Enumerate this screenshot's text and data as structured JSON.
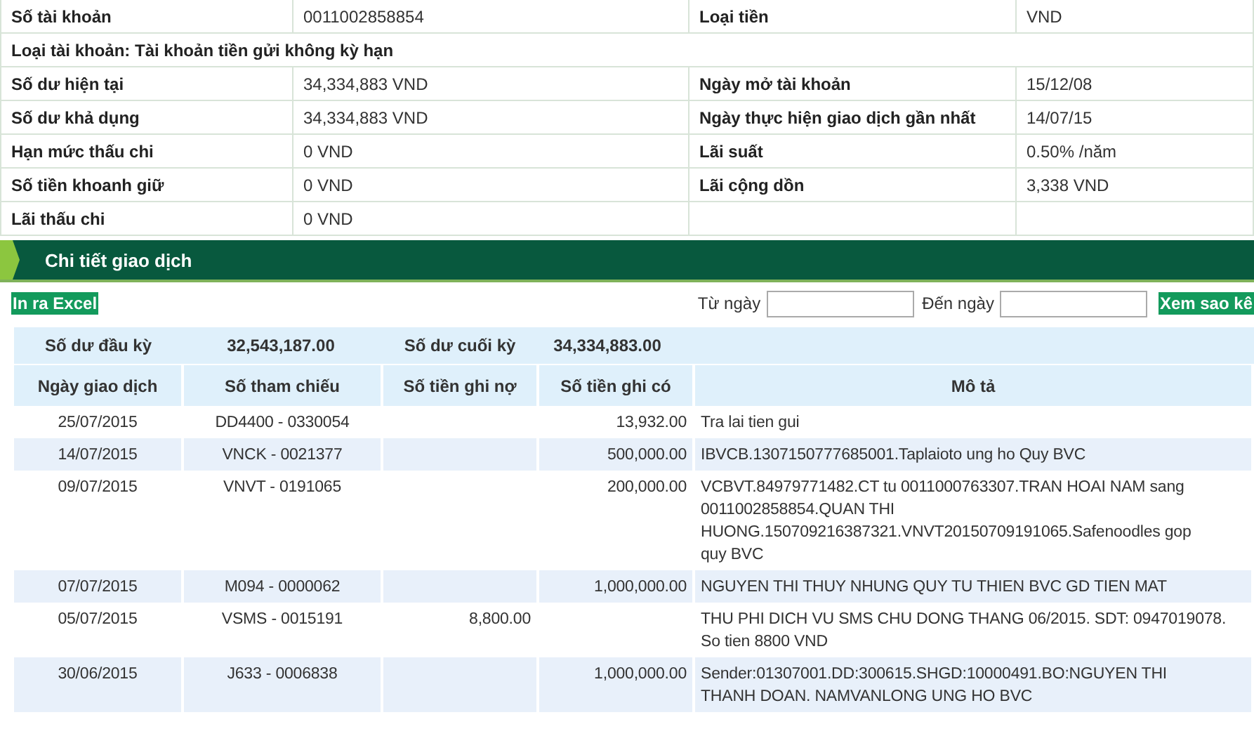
{
  "account_info": {
    "rows": [
      {
        "kind": "pair",
        "cells": [
          "Số tài khoản",
          "0011002858854",
          "Loại tiền",
          "VND"
        ]
      },
      {
        "kind": "full",
        "cells": [
          "Loại tài khoản: Tài khoản tiền gửi không kỳ hạn"
        ]
      },
      {
        "kind": "pair",
        "cells": [
          "Số dư hiện tại",
          "34,334,883 VND",
          "Ngày mở tài khoản",
          "15/12/08"
        ]
      },
      {
        "kind": "pair",
        "cells": [
          "Số dư khả dụng",
          "34,334,883 VND",
          "Ngày thực hiện giao dịch gần nhất",
          "14/07/15"
        ]
      },
      {
        "kind": "pair",
        "cells": [
          "Hạn mức thấu chi",
          "0 VND",
          "Lãi suất",
          "0.50% /năm"
        ]
      },
      {
        "kind": "pair",
        "cells": [
          "Số tiền khoanh giữ",
          "0 VND",
          "Lãi cộng dồn",
          "3,338 VND"
        ]
      },
      {
        "kind": "pair",
        "cells": [
          "Lãi thấu chi",
          "0 VND"
        ]
      }
    ]
  },
  "section": {
    "title": "Chi tiết giao dịch"
  },
  "toolbar": {
    "export_button": "In ra Excel",
    "from_label": "Từ ngày",
    "to_label": "Đến ngày",
    "view_button": "Xem sao kê"
  },
  "summary": {
    "opening_label": "Số dư đầu kỳ",
    "opening_value": "32,543,187.00",
    "closing_label": "Số dư cuối kỳ",
    "closing_value": "34,334,883.00"
  },
  "table": {
    "columns": [
      "Ngày giao dịch",
      "Số tham chiếu",
      "Số tiền ghi nợ",
      "Số tiền ghi có",
      "Mô tả"
    ],
    "rows": [
      {
        "date": "25/07/2015",
        "ref": "DD4400 - 0330054",
        "debit": "",
        "credit": "13,932.00",
        "description": [
          "Tra lai tien gui"
        ]
      },
      {
        "date": "14/07/2015",
        "ref": "VNCK - 0021377",
        "debit": "",
        "credit": "500,000.00",
        "description": [
          "IBVCB.1307150777685001.Taplaioto ung ho Quy BVC"
        ]
      },
      {
        "date": "09/07/2015",
        "ref": "VNVT - 0191065",
        "debit": "",
        "credit": "200,000.00",
        "description": [
          "VCBVT.84979771482.CT tu 0011000763307.TRAN HOAI NAM sang",
          "0011002858854.QUAN THI",
          "HUONG.150709216387321.VNVT20150709191065.Safenoodles gop",
          "quy BVC"
        ]
      },
      {
        "date": "07/07/2015",
        "ref": "M094 - 0000062",
        "debit": "",
        "credit": "1,000,000.00",
        "description": [
          "NGUYEN THI THUY NHUNG QUY TU THIEN BVC GD TIEN MAT"
        ]
      },
      {
        "date": "05/07/2015",
        "ref": "VSMS - 0015191",
        "debit": "8,800.00",
        "credit": "",
        "description": [
          "THU PHI DICH VU SMS CHU DONG THANG 06/2015. SDT: 0947019078.",
          "So tien 8800 VND"
        ]
      },
      {
        "date": "30/06/2015",
        "ref": "J633 - 0006838",
        "debit": "",
        "credit": "1,000,000.00",
        "description": [
          "Sender:01307001.DD:300615.SHGD:10000491.BO:NGUYEN THI",
          "THANH DOAN. NAMVANLONG UNG HO BVC"
        ]
      }
    ]
  }
}
